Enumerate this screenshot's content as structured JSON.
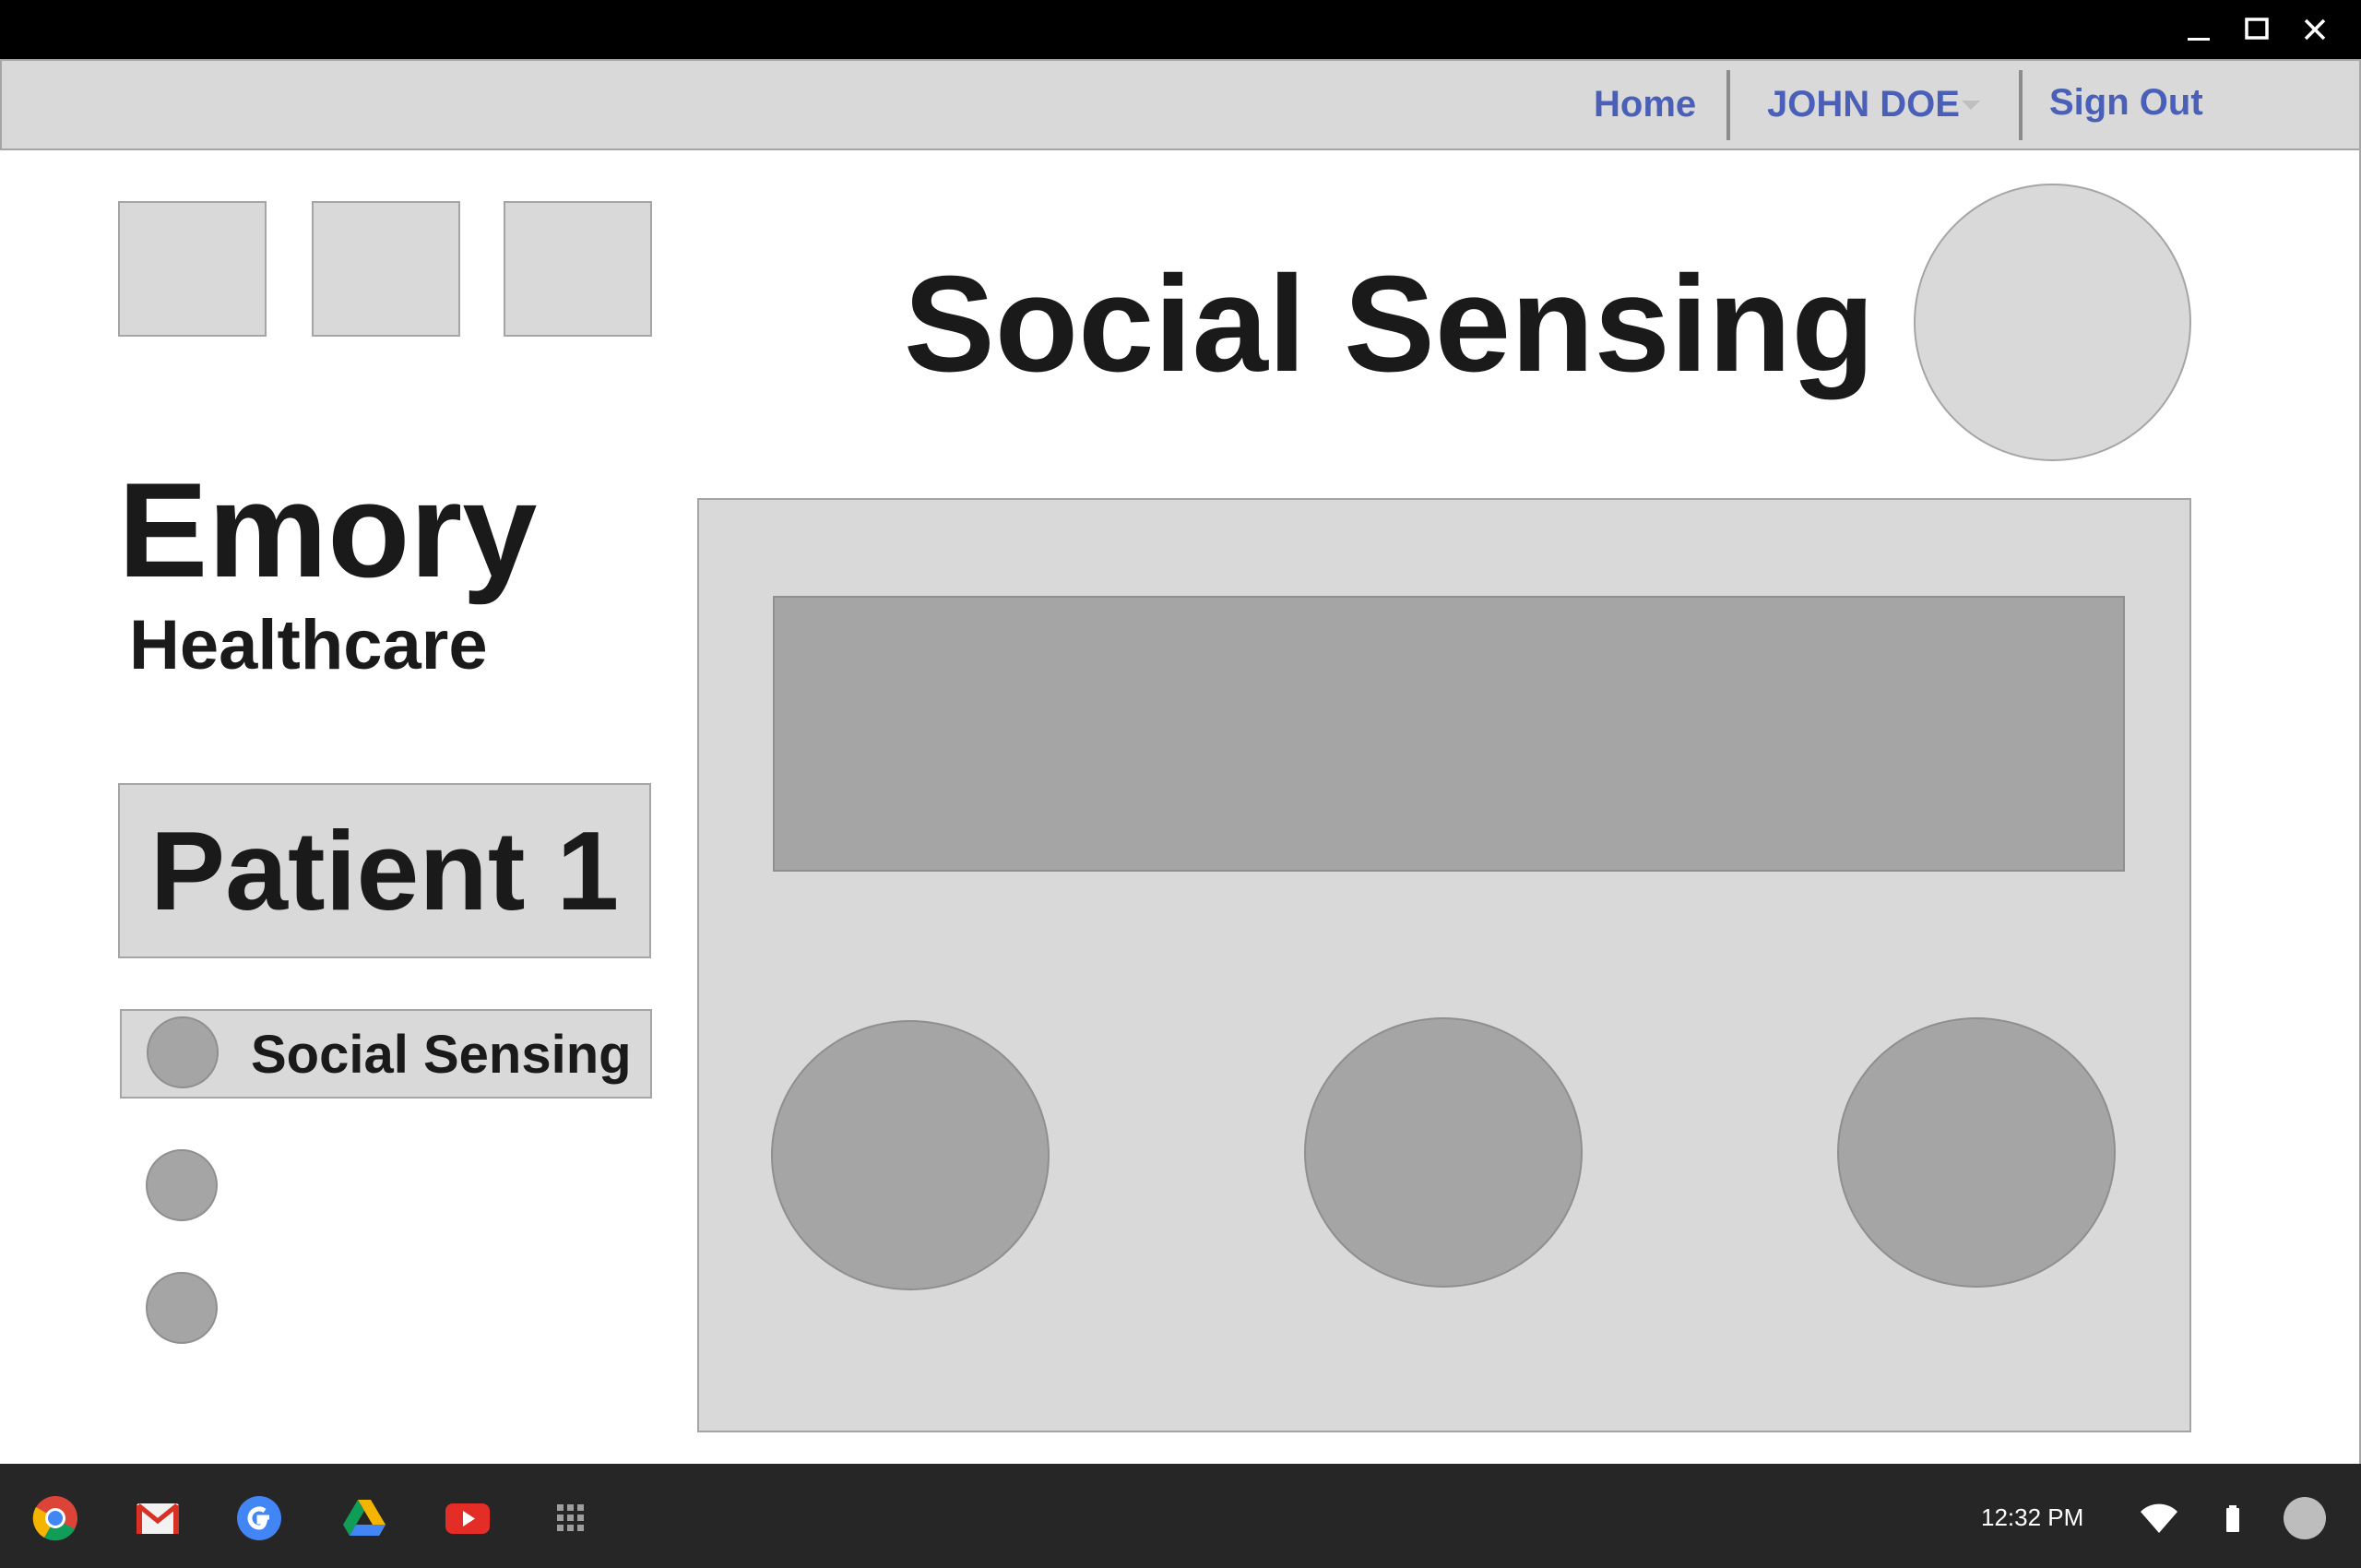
{
  "window_controls": {
    "minimize_icon": "minimize-icon",
    "maximize_icon": "maximize-icon",
    "close_icon": "close-icon"
  },
  "nav": {
    "home": "Home",
    "user": "JOHN DOE",
    "signout": "Sign Out",
    "link_color": "#4a60b8"
  },
  "header": {
    "title": "Social Sensing"
  },
  "brand": {
    "line1": "Emory",
    "line2": "Healthcare"
  },
  "sidebar": {
    "patient": "Patient 1",
    "items": [
      {
        "label": "Social Sensing"
      }
    ]
  },
  "taskbar": {
    "apps": [
      "chrome-icon",
      "gmail-icon",
      "google-icon",
      "drive-icon",
      "youtube-icon",
      "app-launcher-icon"
    ],
    "time": "12:32 PM",
    "status_icons": [
      "wifi-icon",
      "battery-icon",
      "account-icon"
    ]
  },
  "colors": {
    "placeholder_light": "#d9d9d9",
    "placeholder_dark": "#a5a5a5",
    "taskbar": "#262626"
  }
}
